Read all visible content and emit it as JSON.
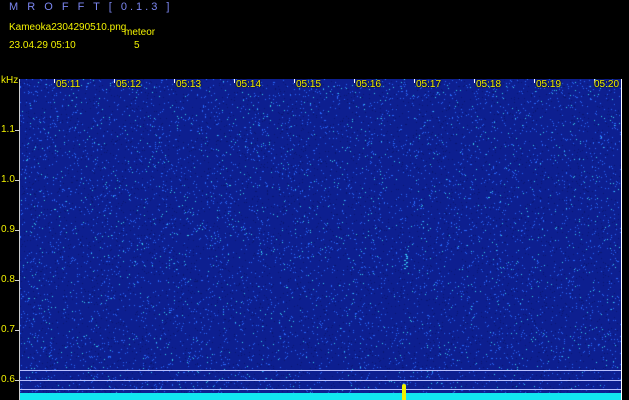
{
  "window": {
    "title": "M R O F F T  [ 0.1.3 ]"
  },
  "info": {
    "file_name": "Kameoka2304290510.png",
    "date_time": "23.04.29 05:10",
    "meteor_label": "meteor",
    "meteor_count": "5"
  },
  "spectrogram": {
    "y_unit": "kHz",
    "y_ticks": [
      "1.1",
      "1.0",
      "0.9",
      "0.8",
      "0.7",
      "0.6"
    ],
    "x_ticks": [
      "05:11",
      "05:12",
      "05:13",
      "05:14",
      "05:15",
      "05:16",
      "05:17",
      "05:18",
      "05:19",
      "05:20"
    ],
    "colors": {
      "background": "#0d1f90",
      "noise_dark": "#0a1670",
      "noise_light": "#2a6cff",
      "noise_cyan": "#3cd8f0",
      "baseline": "#12e6f0",
      "labels": "#f2f200",
      "title": "#7b86f0"
    }
  }
}
